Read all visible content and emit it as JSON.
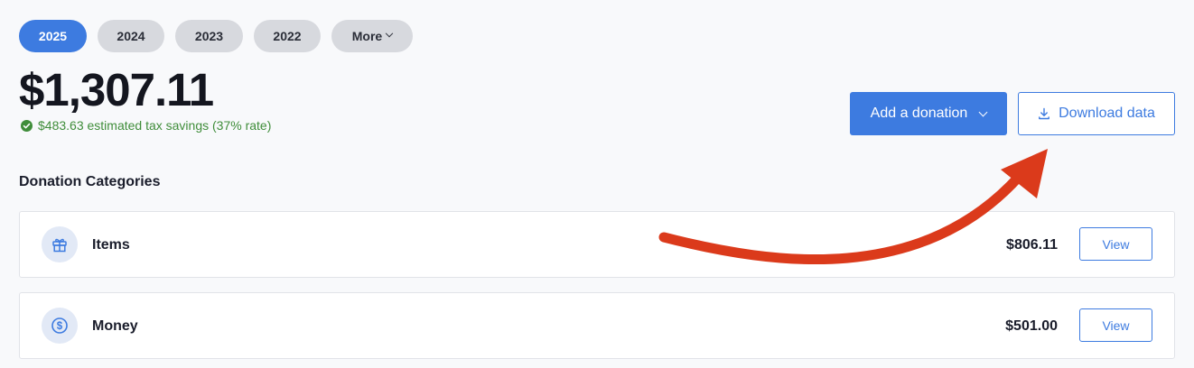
{
  "year_tabs": {
    "items": [
      "2025",
      "2024",
      "2023",
      "2022"
    ],
    "more_label": "More",
    "active": "2025"
  },
  "summary": {
    "total": "$1,307.11",
    "savings_text": "$483.63 estimated tax savings (37% rate)"
  },
  "actions": {
    "add_donation_label": "Add a donation",
    "download_label": "Download data"
  },
  "categories": {
    "title": "Donation Categories",
    "rows": [
      {
        "label": "Items",
        "amount": "$806.11",
        "view_label": "View",
        "icon": "gift-icon"
      },
      {
        "label": "Money",
        "amount": "$501.00",
        "view_label": "View",
        "icon": "dollar-coin-icon"
      }
    ]
  },
  "colors": {
    "accent": "#3d7be0",
    "success": "#3f8d3a",
    "annotation_arrow": "#db3a1b"
  }
}
